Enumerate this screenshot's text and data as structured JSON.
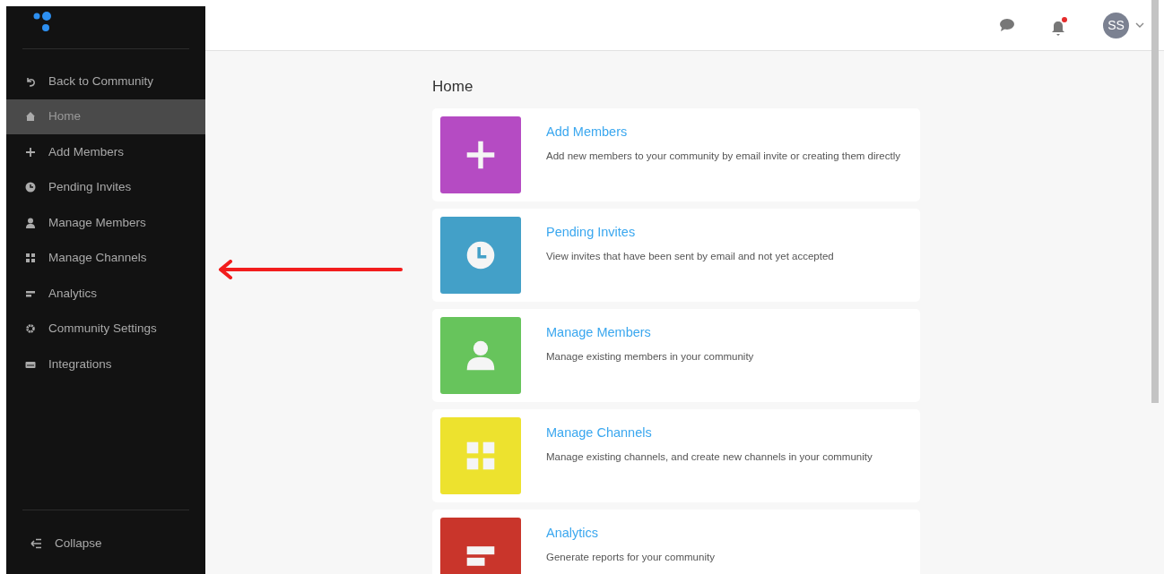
{
  "sidebar": {
    "items": [
      {
        "label": "Back to Community",
        "selected": false
      },
      {
        "label": "Home",
        "selected": true
      },
      {
        "label": "Add Members",
        "selected": false
      },
      {
        "label": "Pending Invites",
        "selected": false
      },
      {
        "label": "Manage Members",
        "selected": false
      },
      {
        "label": "Manage Channels",
        "selected": false
      },
      {
        "label": "Analytics",
        "selected": false
      },
      {
        "label": "Community Settings",
        "selected": false
      },
      {
        "label": "Integrations",
        "selected": false
      }
    ],
    "collapse": "Collapse"
  },
  "header": {
    "avatar": "SS",
    "notifications_unread": true
  },
  "page_title": "Home",
  "cards": [
    {
      "title": "Add Members",
      "description": "Add new members to your community by email invite or creating them directly",
      "color": "#b54bc3"
    },
    {
      "title": "Pending Invites",
      "description": "View invites that have been sent by email and not yet accepted",
      "color": "#43a0c8"
    },
    {
      "title": "Manage Members",
      "description": "Manage existing members in your community",
      "color": "#67c45c"
    },
    {
      "title": "Manage Channels",
      "description": "Manage existing channels, and create new channels in your community",
      "color": "#ede22e"
    },
    {
      "title": "Analytics",
      "description": "Generate reports for your community",
      "color": "#c9352b"
    }
  ]
}
